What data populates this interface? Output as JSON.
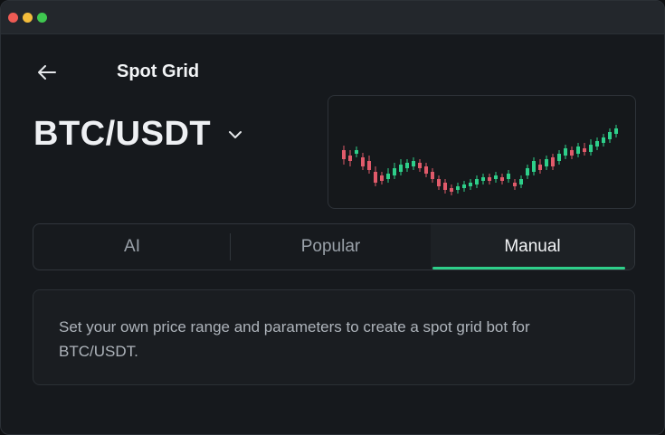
{
  "header": {
    "title": "Spot Grid"
  },
  "pair": {
    "name": "BTC/USDT"
  },
  "tabs": [
    {
      "label": "AI",
      "active": false
    },
    {
      "label": "Popular",
      "active": false
    },
    {
      "label": "Manual",
      "active": true
    }
  ],
  "info": {
    "text": "Set your own price range and parameters to create a spot grid bot for BTC/USDT."
  },
  "colors": {
    "accent": "#2ecf8a",
    "up": "#2ecf8a",
    "down": "#e05a6a"
  },
  "icons": {
    "back": "arrow-left-icon",
    "dropdown": "chevron-down-icon"
  }
}
